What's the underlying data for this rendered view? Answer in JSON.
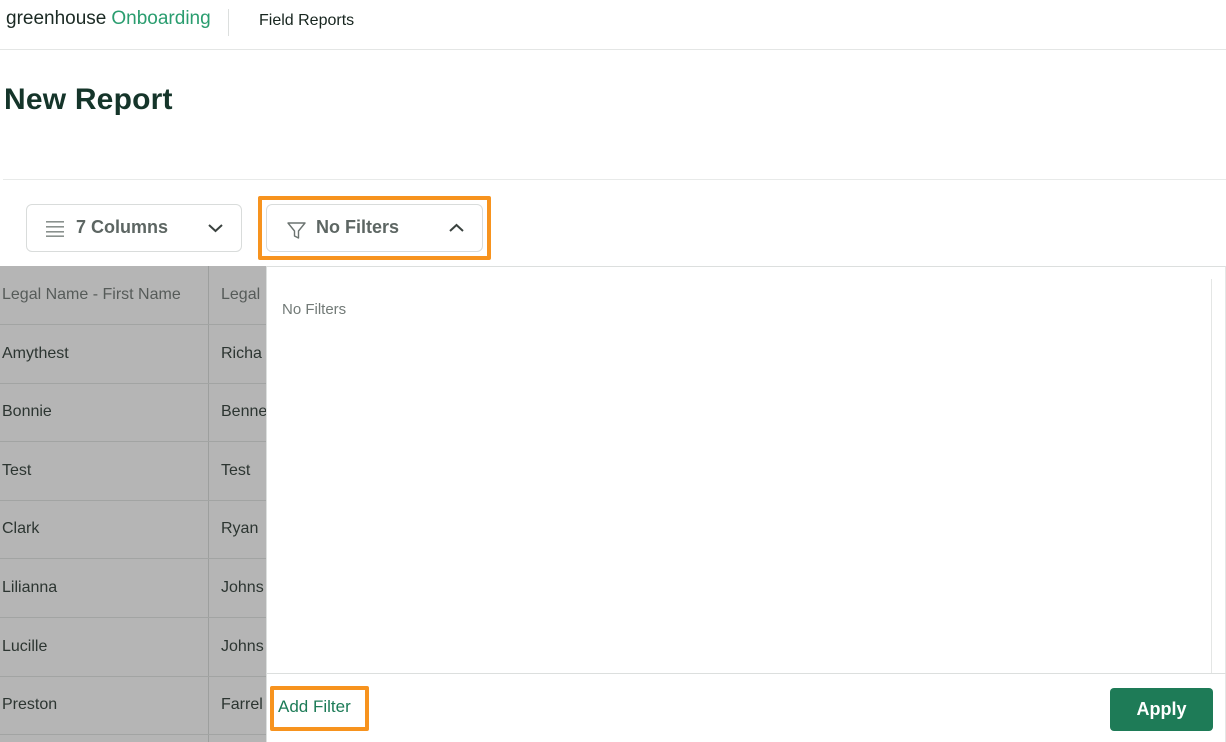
{
  "topbar": {
    "logo_word": "greenhouse",
    "logo_product": "Onboarding",
    "nav_link": "Field Reports"
  },
  "page": {
    "title": "New Report"
  },
  "toolbar": {
    "columns_label": "7 Columns",
    "columns_icon": "list-icon",
    "filters_label": "No Filters",
    "filters_icon": "funnel-icon"
  },
  "table": {
    "headers": [
      "Legal Name - First Name",
      "Legal"
    ],
    "rows": [
      [
        "Amythest",
        "Richa"
      ],
      [
        "Bonnie",
        "Benne"
      ],
      [
        "Test",
        "Test"
      ],
      [
        "Clark",
        "Ryan"
      ],
      [
        "Lilianna",
        "Johns"
      ],
      [
        "Lucille",
        "Johns"
      ],
      [
        "Preston",
        "Farrel"
      ]
    ]
  },
  "filter_panel": {
    "empty_text": "No Filters",
    "add_filter_label": "Add Filter",
    "apply_label": "Apply"
  },
  "colors": {
    "brand_green": "#1e7b57",
    "logo_accent": "#2a9d6f",
    "highlight_orange": "#f7931e"
  }
}
